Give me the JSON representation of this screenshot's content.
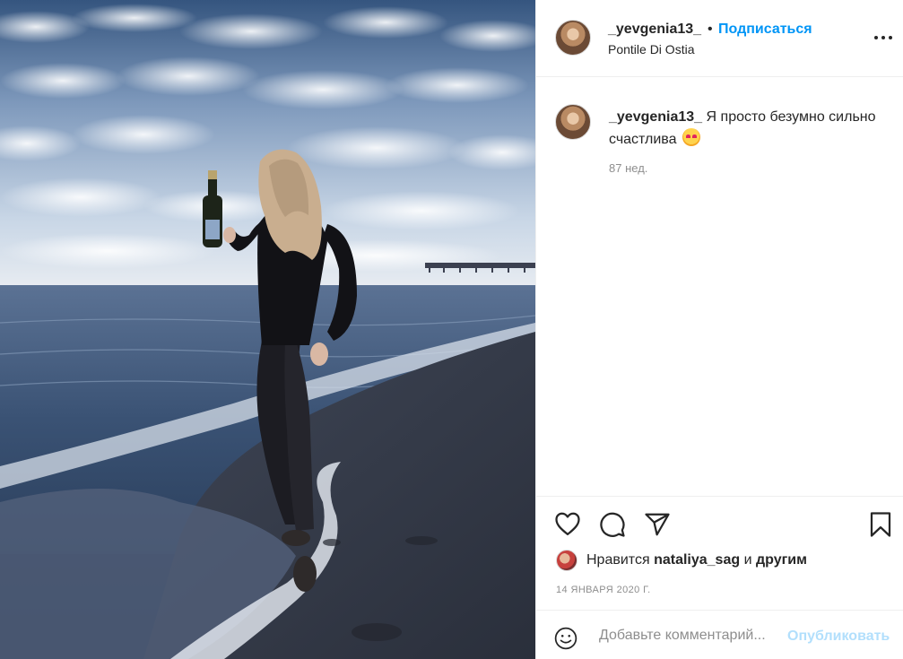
{
  "post": {
    "author": "_yevgenia13_",
    "separator": "•",
    "follow_label": "Подписаться",
    "location": "Pontile Di Ostia",
    "more_icon": "more-horizontal-icon"
  },
  "caption": {
    "username": "_yevgenia13_",
    "text": "Я просто безумно сильно счастлива",
    "emoji": "smiling-face-with-hearts-emoji",
    "time_ago": "87 нед."
  },
  "actions": {
    "like_icon": "heart-icon",
    "comment_icon": "comment-icon",
    "share_icon": "paper-plane-icon",
    "save_icon": "bookmark-icon"
  },
  "likes": {
    "prefix": "Нравится",
    "user": "nataliya_sag",
    "suffix": "и",
    "others": "другим"
  },
  "date": "14 января 2020 г.",
  "comment_box": {
    "placeholder": "Добавьте комментарий...",
    "post_label": "Опубликовать",
    "emoji_icon": "smiley-icon"
  },
  "colors": {
    "accent": "#0095f6",
    "post_disabled": "#b2dffc",
    "muted": "#8e8e8e"
  }
}
